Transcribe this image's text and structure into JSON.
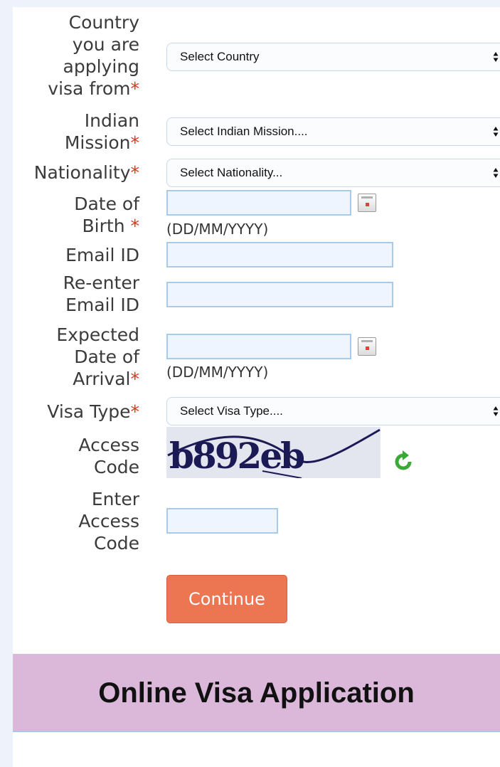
{
  "form": {
    "country_label": "Country you are applying visa from",
    "country_label_lines": [
      "Country",
      "you are",
      "applying",
      "visa from"
    ],
    "country_select": "Select Country",
    "mission_label_lines": [
      "Indian",
      "Mission"
    ],
    "mission_select": "Select Indian Mission....",
    "nationality_label": "Nationality",
    "nationality_select": "Select Nationality...",
    "dob_label_lines": [
      "Date of",
      "Birth "
    ],
    "dob_format": "(DD/MM/YYYY)",
    "email_label": "Email ID",
    "reemail_label_lines": [
      "Re-enter",
      "Email ID"
    ],
    "arrival_label_lines": [
      "Expected",
      "Date of",
      "Arrival"
    ],
    "arrival_format": "(DD/MM/YYYY)",
    "visa_type_label": "Visa Type",
    "visa_type_select": "Select Visa Type....",
    "access_code_label_lines": [
      "Access",
      "Code"
    ],
    "captcha_text": "b892eb",
    "enter_access_label_lines": [
      "Enter",
      "Access",
      "Code"
    ],
    "required_mark": "*",
    "continue_label": "Continue"
  },
  "banner": {
    "title": "Online Visa Application"
  },
  "colors": {
    "required": "#e0311d",
    "button": "#ec7552",
    "banner": "#dbb8da",
    "refresh_icon": "#3aa935"
  },
  "icons": {
    "calendar": "calendar-icon",
    "refresh": "refresh-icon",
    "select_arrows": "updown-arrows-icon"
  }
}
